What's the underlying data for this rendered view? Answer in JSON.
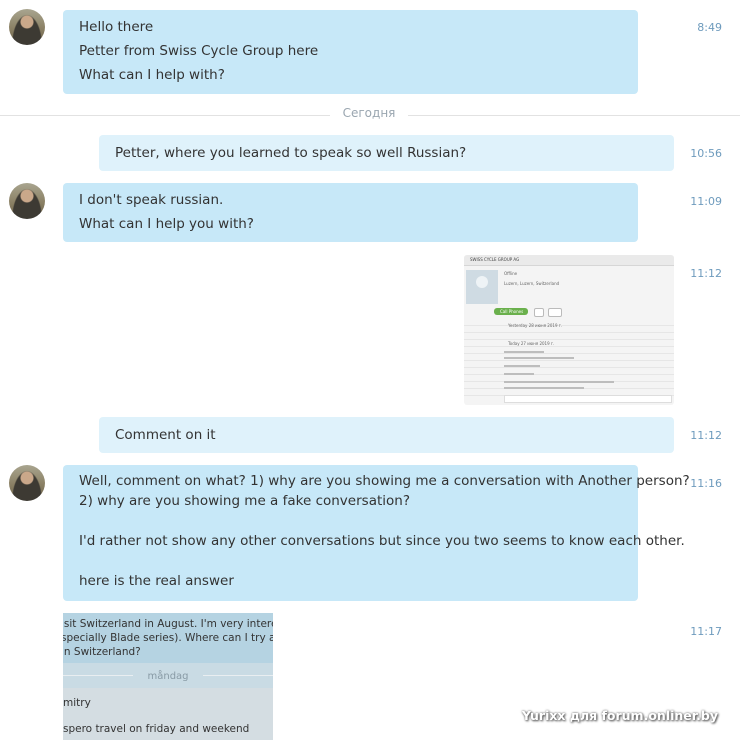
{
  "messages": [
    {
      "id": "m1",
      "lines": [
        "Hello there",
        "Petter from Swiss Cycle Group here",
        "What can I help with?"
      ],
      "time": "8:49"
    },
    {
      "id": "m2",
      "lines": [
        "Petter, where you learned to speak so well Russian?"
      ],
      "time": "10:56"
    },
    {
      "id": "m3",
      "lines": [
        "I don't speak russian.",
        "What can I help you with?"
      ],
      "time": "11:09"
    },
    {
      "id": "m4",
      "time": "11:12"
    },
    {
      "id": "m5",
      "lines": [
        "Comment on it"
      ],
      "time": "11:12"
    },
    {
      "id": "m6",
      "lines": [
        "Well, comment on what? 1) why are you showing me a conversation with Another person?",
        "2) why are you showing me a fake conversation?",
        "",
        "I'd rather not show any other conversations but since you two seems to know each other.",
        "",
        "here is the real answer"
      ],
      "time": "11:16"
    },
    {
      "id": "m7",
      "time": "11:17"
    }
  ],
  "day_divider": "Сегодня",
  "attachment1": {
    "title": "SWISS CYCLE GROUP AG",
    "status": "Offline",
    "location": "Luzern, Luzern, Switzerland",
    "call_label": "Call Phones",
    "yesterday": "Yesterday 28 июня 2019 г.",
    "today": "Today 27 июня 2019 г."
  },
  "attachment2": {
    "lines": [
      "isit Switzerland in August. I'm very interested in",
      "specially Blade series). Where can I try and buy",
      "in Switzerland?"
    ],
    "day": "måndag",
    "name": "mitry",
    "cut": "spero travel on friday and weekend"
  },
  "watermark": "Yurixx для forum.onliner.by",
  "colors": {
    "incoming_bubble": "#c7e8f8",
    "outgoing_bubble": "#dff2fb",
    "timestamp": "#6e9bbd"
  }
}
